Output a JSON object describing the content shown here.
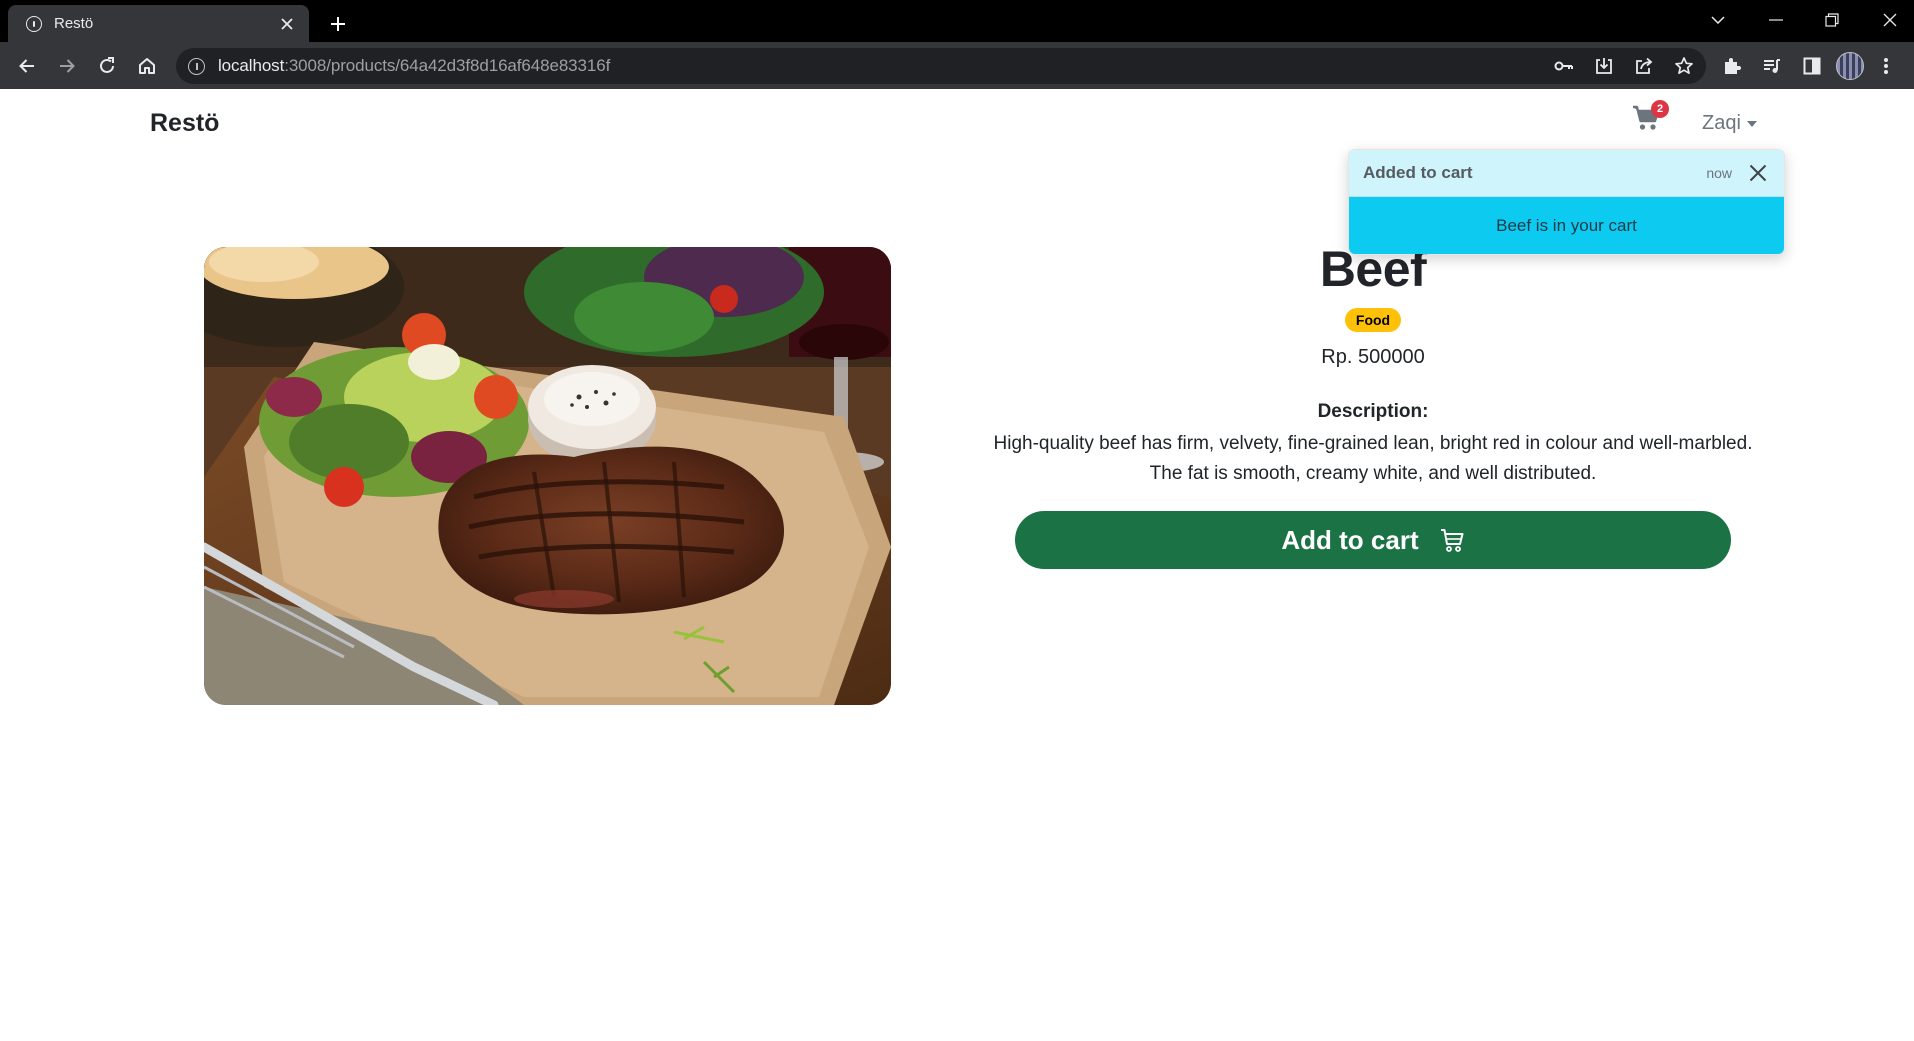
{
  "browser": {
    "tab_title": "Restö",
    "url_host": "localhost",
    "url_path": ":3008/products/64a42d3f8d16af648e83316f"
  },
  "navbar": {
    "brand": "Restö",
    "cart_count": "2",
    "user_name": "Zaqi"
  },
  "toast": {
    "title": "Added to cart",
    "time": "now",
    "message": "Beef is in your cart"
  },
  "product": {
    "name": "Beef",
    "category": "Food",
    "price": "Rp. 500000",
    "description_label": "Description:",
    "description": "High-quality beef has firm, velvety, fine-grained lean, bright red in colour and well-marbled. The fat is smooth, creamy white, and well distributed.",
    "add_to_cart_label": "Add to cart"
  },
  "colors": {
    "add_button": "#1b7345",
    "badge_category": "#ffc107",
    "toast_body": "#0dcaf0",
    "toast_header": "#cff4fc",
    "cart_badge": "#dc3545"
  }
}
